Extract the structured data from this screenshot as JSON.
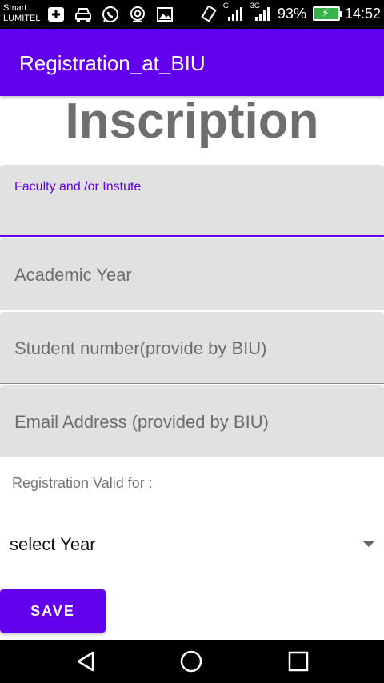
{
  "status_bar": {
    "carrier_line1": "Smart",
    "carrier_line2": "LUMITEL",
    "network_label_1": "G",
    "network_label_2": "3G",
    "battery_percent": "93%",
    "time": "14:52",
    "battery_color": "#36b24a"
  },
  "app_bar": {
    "title": "Registration_at_BIU",
    "color": "#6200ee"
  },
  "page": {
    "heading": "Inscription"
  },
  "form": {
    "faculty_label": "Faculty and /or Instute",
    "faculty_value": "",
    "academic_year_hint": "Academic Year",
    "student_number_hint": "Student number(provide by BIU)",
    "email_hint": "Email Address (provided by BIU)",
    "valid_for_label": "Registration Valid for :",
    "year_select_value": "select Year",
    "save_label": "SAVE"
  },
  "nav_bar": {
    "icons": [
      "back-icon",
      "home-icon",
      "recents-icon"
    ]
  }
}
